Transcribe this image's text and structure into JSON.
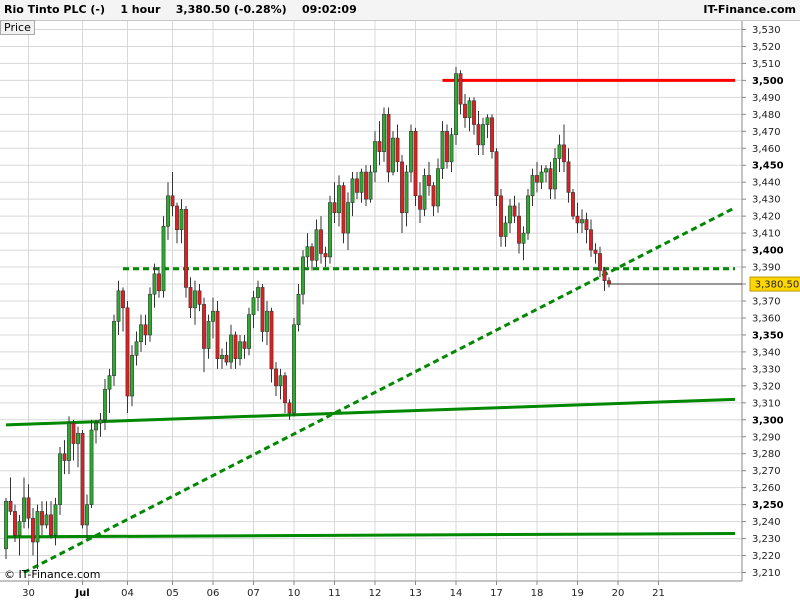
{
  "header": {
    "instrument": "Rio Tinto PLC (-)",
    "interval": "1 hour",
    "last": "3,380.50 (-0.28%)",
    "time": "09:02:09",
    "brand": "IT-Finance.com"
  },
  "price_tab": "Price",
  "copyright": "© IT-Finance.com",
  "current_price_label": "3,380.50",
  "colors": {
    "up": "#2eaa2e",
    "down": "#e02020",
    "resistance": "#ff0000",
    "support": "#008800",
    "grid": "#d8d8d8"
  },
  "chart_data": {
    "type": "candlestick",
    "ylim": [
      3205,
      3535
    ],
    "y_ticks": [
      {
        "v": 3210,
        "label": "3,210"
      },
      {
        "v": 3220,
        "label": "3,220"
      },
      {
        "v": 3230,
        "label": "3,230"
      },
      {
        "v": 3240,
        "label": "3,240"
      },
      {
        "v": 3250,
        "label": "3,250",
        "major": true
      },
      {
        "v": 3260,
        "label": "3,260"
      },
      {
        "v": 3270,
        "label": "3,270"
      },
      {
        "v": 3280,
        "label": "3,280"
      },
      {
        "v": 3290,
        "label": "3,290"
      },
      {
        "v": 3300,
        "label": "3,300",
        "major": true
      },
      {
        "v": 3310,
        "label": "3,310"
      },
      {
        "v": 3320,
        "label": "3,320"
      },
      {
        "v": 3330,
        "label": "3,330"
      },
      {
        "v": 3340,
        "label": "3,340"
      },
      {
        "v": 3350,
        "label": "3,350",
        "major": true
      },
      {
        "v": 3360,
        "label": "3,360"
      },
      {
        "v": 3370,
        "label": "3,370"
      },
      {
        "v": 3380,
        "label": "3,380"
      },
      {
        "v": 3390,
        "label": "3,390"
      },
      {
        "v": 3400,
        "label": "3,400",
        "major": true
      },
      {
        "v": 3410,
        "label": "3,410"
      },
      {
        "v": 3420,
        "label": "3,420"
      },
      {
        "v": 3430,
        "label": "3,430"
      },
      {
        "v": 3440,
        "label": "3,440"
      },
      {
        "v": 3450,
        "label": "3,450",
        "major": true
      },
      {
        "v": 3460,
        "label": "3,460"
      },
      {
        "v": 3470,
        "label": "3,470"
      },
      {
        "v": 3480,
        "label": "3,480"
      },
      {
        "v": 3490,
        "label": "3,490"
      },
      {
        "v": 3500,
        "label": "3,500",
        "major": true
      },
      {
        "v": 3510,
        "label": "3,510"
      },
      {
        "v": 3520,
        "label": "3,520"
      },
      {
        "v": 3530,
        "label": "3,530"
      }
    ],
    "x_ticks": [
      {
        "i": 5,
        "label": "30"
      },
      {
        "i": 17,
        "label": "Jul",
        "major": true
      },
      {
        "i": 27,
        "label": "04"
      },
      {
        "i": 37,
        "label": "05"
      },
      {
        "i": 46,
        "label": "06"
      },
      {
        "i": 55,
        "label": "07"
      },
      {
        "i": 64,
        "label": "10"
      },
      {
        "i": 73,
        "label": "11"
      },
      {
        "i": 82,
        "label": "12"
      },
      {
        "i": 91,
        "label": "13"
      },
      {
        "i": 100,
        "label": "14"
      },
      {
        "i": 109,
        "label": "17"
      },
      {
        "i": 118,
        "label": "18"
      },
      {
        "i": 127,
        "label": "19"
      },
      {
        "i": 136,
        "label": "20"
      },
      {
        "i": 145,
        "label": "21"
      }
    ],
    "candles": [
      [
        3224,
        3254,
        3218,
        3252
      ],
      [
        3252,
        3266,
        3244,
        3246
      ],
      [
        3246,
        3250,
        3228,
        3232
      ],
      [
        3232,
        3244,
        3220,
        3240
      ],
      [
        3240,
        3266,
        3236,
        3254
      ],
      [
        3254,
        3262,
        3236,
        3242
      ],
      [
        3242,
        3248,
        3220,
        3228
      ],
      [
        3228,
        3250,
        3212,
        3246
      ],
      [
        3246,
        3252,
        3232,
        3238
      ],
      [
        3238,
        3252,
        3236,
        3244
      ],
      [
        3244,
        3252,
        3230,
        3232
      ],
      [
        3232,
        3254,
        3226,
        3250
      ],
      [
        3250,
        3284,
        3244,
        3280
      ],
      [
        3280,
        3288,
        3268,
        3276
      ],
      [
        3276,
        3302,
        3268,
        3298
      ],
      [
        3298,
        3300,
        3276,
        3286
      ],
      [
        3286,
        3296,
        3272,
        3292
      ],
      [
        3292,
        3294,
        3236,
        3238
      ],
      [
        3238,
        3256,
        3230,
        3250
      ],
      [
        3250,
        3300,
        3248,
        3294
      ],
      [
        3294,
        3300,
        3286,
        3298
      ],
      [
        3298,
        3304,
        3290,
        3300
      ],
      [
        3300,
        3324,
        3294,
        3318
      ],
      [
        3318,
        3330,
        3304,
        3326
      ],
      [
        3326,
        3362,
        3320,
        3358
      ],
      [
        3358,
        3382,
        3350,
        3376
      ],
      [
        3376,
        3378,
        3352,
        3366
      ],
      [
        3366,
        3370,
        3304,
        3314
      ],
      [
        3314,
        3344,
        3308,
        3338
      ],
      [
        3338,
        3352,
        3332,
        3346
      ],
      [
        3346,
        3362,
        3340,
        3356
      ],
      [
        3356,
        3362,
        3344,
        3350
      ],
      [
        3350,
        3378,
        3346,
        3374
      ],
      [
        3374,
        3392,
        3366,
        3386
      ],
      [
        3386,
        3390,
        3372,
        3376
      ],
      [
        3376,
        3420,
        3372,
        3414
      ],
      [
        3414,
        3440,
        3406,
        3432
      ],
      [
        3432,
        3446,
        3420,
        3426
      ],
      [
        3426,
        3428,
        3404,
        3412
      ],
      [
        3412,
        3430,
        3404,
        3424
      ],
      [
        3424,
        3426,
        3372,
        3378
      ],
      [
        3378,
        3384,
        3360,
        3366
      ],
      [
        3366,
        3382,
        3356,
        3376
      ],
      [
        3376,
        3380,
        3364,
        3368
      ],
      [
        3368,
        3372,
        3328,
        3342
      ],
      [
        3342,
        3362,
        3336,
        3358
      ],
      [
        3358,
        3372,
        3348,
        3364
      ],
      [
        3364,
        3370,
        3330,
        3336
      ],
      [
        3336,
        3342,
        3330,
        3338
      ],
      [
        3338,
        3346,
        3332,
        3334
      ],
      [
        3334,
        3356,
        3330,
        3350
      ],
      [
        3350,
        3352,
        3330,
        3336
      ],
      [
        3336,
        3350,
        3332,
        3346
      ],
      [
        3346,
        3350,
        3336,
        3342
      ],
      [
        3342,
        3366,
        3338,
        3362
      ],
      [
        3362,
        3376,
        3354,
        3372
      ],
      [
        3372,
        3382,
        3364,
        3378
      ],
      [
        3378,
        3380,
        3346,
        3352
      ],
      [
        3352,
        3370,
        3344,
        3364
      ],
      [
        3364,
        3366,
        3322,
        3330
      ],
      [
        3330,
        3334,
        3314,
        3320
      ],
      [
        3320,
        3330,
        3312,
        3326
      ],
      [
        3326,
        3328,
        3304,
        3310
      ],
      [
        3310,
        3312,
        3300,
        3304
      ],
      [
        3304,
        3360,
        3302,
        3356
      ],
      [
        3356,
        3380,
        3352,
        3374
      ],
      [
        3374,
        3400,
        3368,
        3396
      ],
      [
        3396,
        3410,
        3390,
        3402
      ],
      [
        3402,
        3404,
        3388,
        3394
      ],
      [
        3394,
        3418,
        3390,
        3412
      ],
      [
        3412,
        3420,
        3392,
        3398
      ],
      [
        3398,
        3402,
        3390,
        3396
      ],
      [
        3396,
        3432,
        3392,
        3428
      ],
      [
        3428,
        3440,
        3416,
        3422
      ],
      [
        3422,
        3444,
        3414,
        3438
      ],
      [
        3438,
        3440,
        3404,
        3410
      ],
      [
        3410,
        3434,
        3400,
        3428
      ],
      [
        3428,
        3446,
        3420,
        3442
      ],
      [
        3442,
        3446,
        3430,
        3434
      ],
      [
        3434,
        3448,
        3428,
        3446
      ],
      [
        3446,
        3450,
        3426,
        3430
      ],
      [
        3430,
        3450,
        3428,
        3446
      ],
      [
        3446,
        3470,
        3440,
        3464
      ],
      [
        3464,
        3476,
        3450,
        3458
      ],
      [
        3458,
        3484,
        3452,
        3480
      ],
      [
        3480,
        3484,
        3440,
        3446
      ],
      [
        3446,
        3470,
        3444,
        3466
      ],
      [
        3466,
        3474,
        3446,
        3452
      ],
      [
        3452,
        3456,
        3410,
        3422
      ],
      [
        3422,
        3450,
        3414,
        3446
      ],
      [
        3446,
        3474,
        3440,
        3470
      ],
      [
        3470,
        3472,
        3426,
        3432
      ],
      [
        3432,
        3440,
        3416,
        3424
      ],
      [
        3424,
        3448,
        3420,
        3444
      ],
      [
        3444,
        3452,
        3432,
        3438
      ],
      [
        3438,
        3440,
        3420,
        3426
      ],
      [
        3426,
        3454,
        3422,
        3448
      ],
      [
        3448,
        3476,
        3442,
        3470
      ],
      [
        3470,
        3474,
        3448,
        3452
      ],
      [
        3452,
        3472,
        3446,
        3468
      ],
      [
        3468,
        3508,
        3462,
        3504
      ],
      [
        3504,
        3506,
        3480,
        3486
      ],
      [
        3486,
        3492,
        3472,
        3478
      ],
      [
        3478,
        3490,
        3470,
        3488
      ],
      [
        3488,
        3490,
        3468,
        3474
      ],
      [
        3474,
        3482,
        3456,
        3462
      ],
      [
        3462,
        3478,
        3456,
        3474
      ],
      [
        3474,
        3480,
        3466,
        3478
      ],
      [
        3478,
        3480,
        3454,
        3458
      ],
      [
        3458,
        3460,
        3426,
        3432
      ],
      [
        3432,
        3436,
        3402,
        3408
      ],
      [
        3408,
        3420,
        3402,
        3416
      ],
      [
        3416,
        3430,
        3410,
        3426
      ],
      [
        3426,
        3432,
        3416,
        3420
      ],
      [
        3420,
        3428,
        3398,
        3404
      ],
      [
        3404,
        3414,
        3394,
        3410
      ],
      [
        3410,
        3436,
        3406,
        3432
      ],
      [
        3432,
        3448,
        3426,
        3444
      ],
      [
        3444,
        3452,
        3434,
        3440
      ],
      [
        3440,
        3450,
        3436,
        3446
      ],
      [
        3446,
        3450,
        3440,
        3448
      ],
      [
        3448,
        3452,
        3430,
        3436
      ],
      [
        3436,
        3460,
        3430,
        3454
      ],
      [
        3454,
        3468,
        3446,
        3462
      ],
      [
        3462,
        3474,
        3446,
        3452
      ],
      [
        3452,
        3460,
        3428,
        3434
      ],
      [
        3434,
        3436,
        3418,
        3420
      ],
      [
        3420,
        3428,
        3410,
        3416
      ],
      [
        3416,
        3424,
        3410,
        3418
      ],
      [
        3418,
        3422,
        3404,
        3412
      ],
      [
        3412,
        3418,
        3396,
        3400
      ],
      [
        3400,
        3404,
        3392,
        3398
      ],
      [
        3398,
        3402,
        3384,
        3388
      ],
      [
        3388,
        3390,
        3376,
        3382
      ],
      [
        3382,
        3384,
        3378,
        3380
      ]
    ],
    "lines": [
      {
        "name": "resistance",
        "i1": 97,
        "v1": 3500,
        "i2": 162,
        "v2": 3500,
        "color": "#ff0000",
        "dash": false
      },
      {
        "name": "horizontal-dashed",
        "i1": 26,
        "v1": 3389,
        "i2": 162,
        "v2": 3389,
        "color": "#008800",
        "dash": true
      },
      {
        "name": "rising-trend-dashed",
        "i1": 4,
        "v1": 3210,
        "i2": 162,
        "v2": 3425,
        "color": "#008800",
        "dash": true
      },
      {
        "name": "upper-channel",
        "i1": 0,
        "v1": 3297,
        "i2": 162,
        "v2": 3312,
        "color": "#008800",
        "dash": false
      },
      {
        "name": "lower-support",
        "i1": 0,
        "v1": 3231,
        "i2": 162,
        "v2": 3233,
        "color": "#008800",
        "dash": false
      }
    ]
  }
}
